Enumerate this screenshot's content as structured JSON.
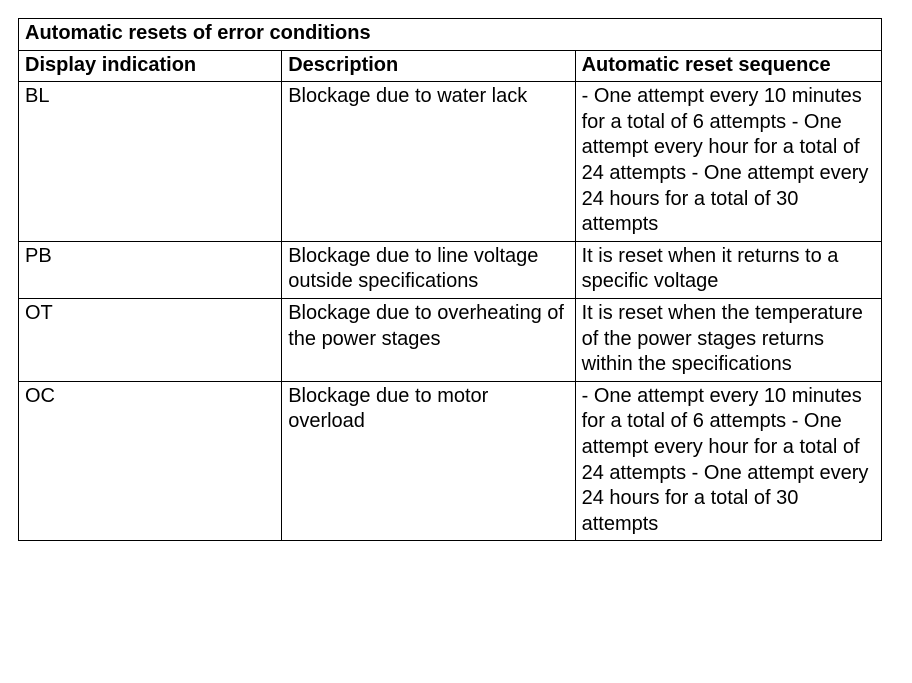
{
  "table": {
    "title": "Automatic resets of error conditions",
    "columns": [
      "Display indication",
      "Description",
      "Automatic reset sequence"
    ],
    "rows": [
      {
        "code": "BL",
        "description": "Blockage due to water lack",
        "reset": "- One attempt every 10 minutes for a total of 6 attempts\n- One attempt every hour for a total of 24 attempts\n- One attempt every 24 hours for a total of 30 attempts"
      },
      {
        "code": "PB",
        "description": "Blockage due to line voltage outside specifications",
        "reset": "It is reset when it returns to a specific voltage"
      },
      {
        "code": "OT",
        "description": "Blockage due to overheating of the power stages",
        "reset": "It is reset when the temperature of the power stages returns within the specifications"
      },
      {
        "code": "OC",
        "description": "Blockage due to motor overload",
        "reset": "- One attempt every 10 minutes for a total of 6 attempts\n- One attempt every hour for a total of 24 attempts\n- One attempt every 24 hours for a total of 30 attempts"
      }
    ]
  }
}
